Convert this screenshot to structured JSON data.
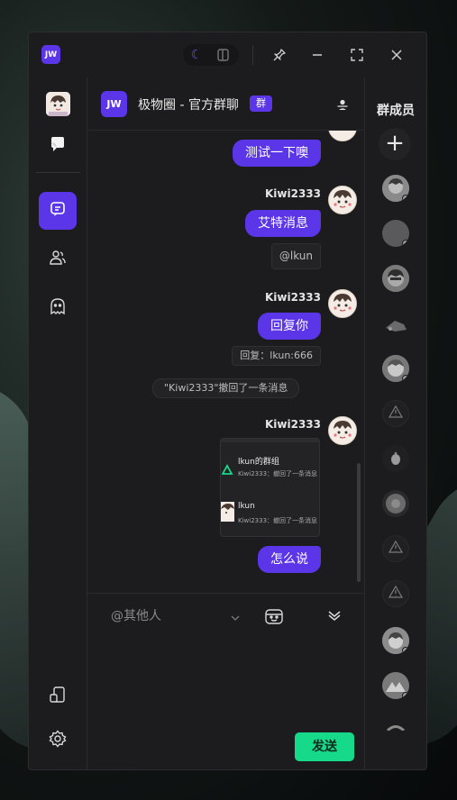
{
  "titlebar": {
    "logo_text": "JW",
    "controls": [
      "theme-toggle",
      "pin",
      "minimize",
      "maximize",
      "close"
    ]
  },
  "leftnav": {
    "items": [
      {
        "name": "user-avatar",
        "icon": "avatar-icon"
      },
      {
        "name": "message-center",
        "icon": "chat-bubble-icon"
      },
      {
        "name": "chat",
        "icon": "chat-icon",
        "active": true
      },
      {
        "name": "friends",
        "icon": "friends-icon"
      },
      {
        "name": "ai",
        "icon": "ghost-icon"
      },
      {
        "name": "device",
        "icon": "device-icon"
      },
      {
        "name": "settings",
        "icon": "gear-icon"
      }
    ]
  },
  "header": {
    "logo_text": "JW",
    "title": "极物圈 - 官方群聊",
    "badge": "群"
  },
  "messages": {
    "m1_bubble": "测试一下噢",
    "m2_sender": "Kiwi2333",
    "m2_bubble": "艾特消息",
    "m2_quote": "@lkun",
    "m3_sender": "Kiwi2333",
    "m3_bubble": "回复你",
    "m3_quote": "回复：lkun:666",
    "system": "\"Kiwi2333\"撤回了一条消息",
    "m4_sender": "Kiwi2333",
    "card": {
      "row1_title": "lkun的群组",
      "row1_sub": "Kiwi2333：撤回了一条消息",
      "row2_title": "lkun",
      "row2_sub": "Kiwi2333：撤回了一条消息"
    },
    "m4_bubble": "怎么说"
  },
  "input": {
    "mention_placeholder": "@其他人",
    "send_label": "发送"
  },
  "members": {
    "title": "群成员",
    "add_label": "+",
    "list": [
      "avatar",
      "gray",
      "avatar",
      "gray",
      "avatar",
      "warn",
      "gray",
      "gray",
      "warn",
      "warn",
      "avatar",
      "avatar",
      "partial"
    ]
  },
  "colors": {
    "accent": "#5b35e8",
    "send": "#17d98a",
    "window_bg": "#1c1c1e"
  }
}
